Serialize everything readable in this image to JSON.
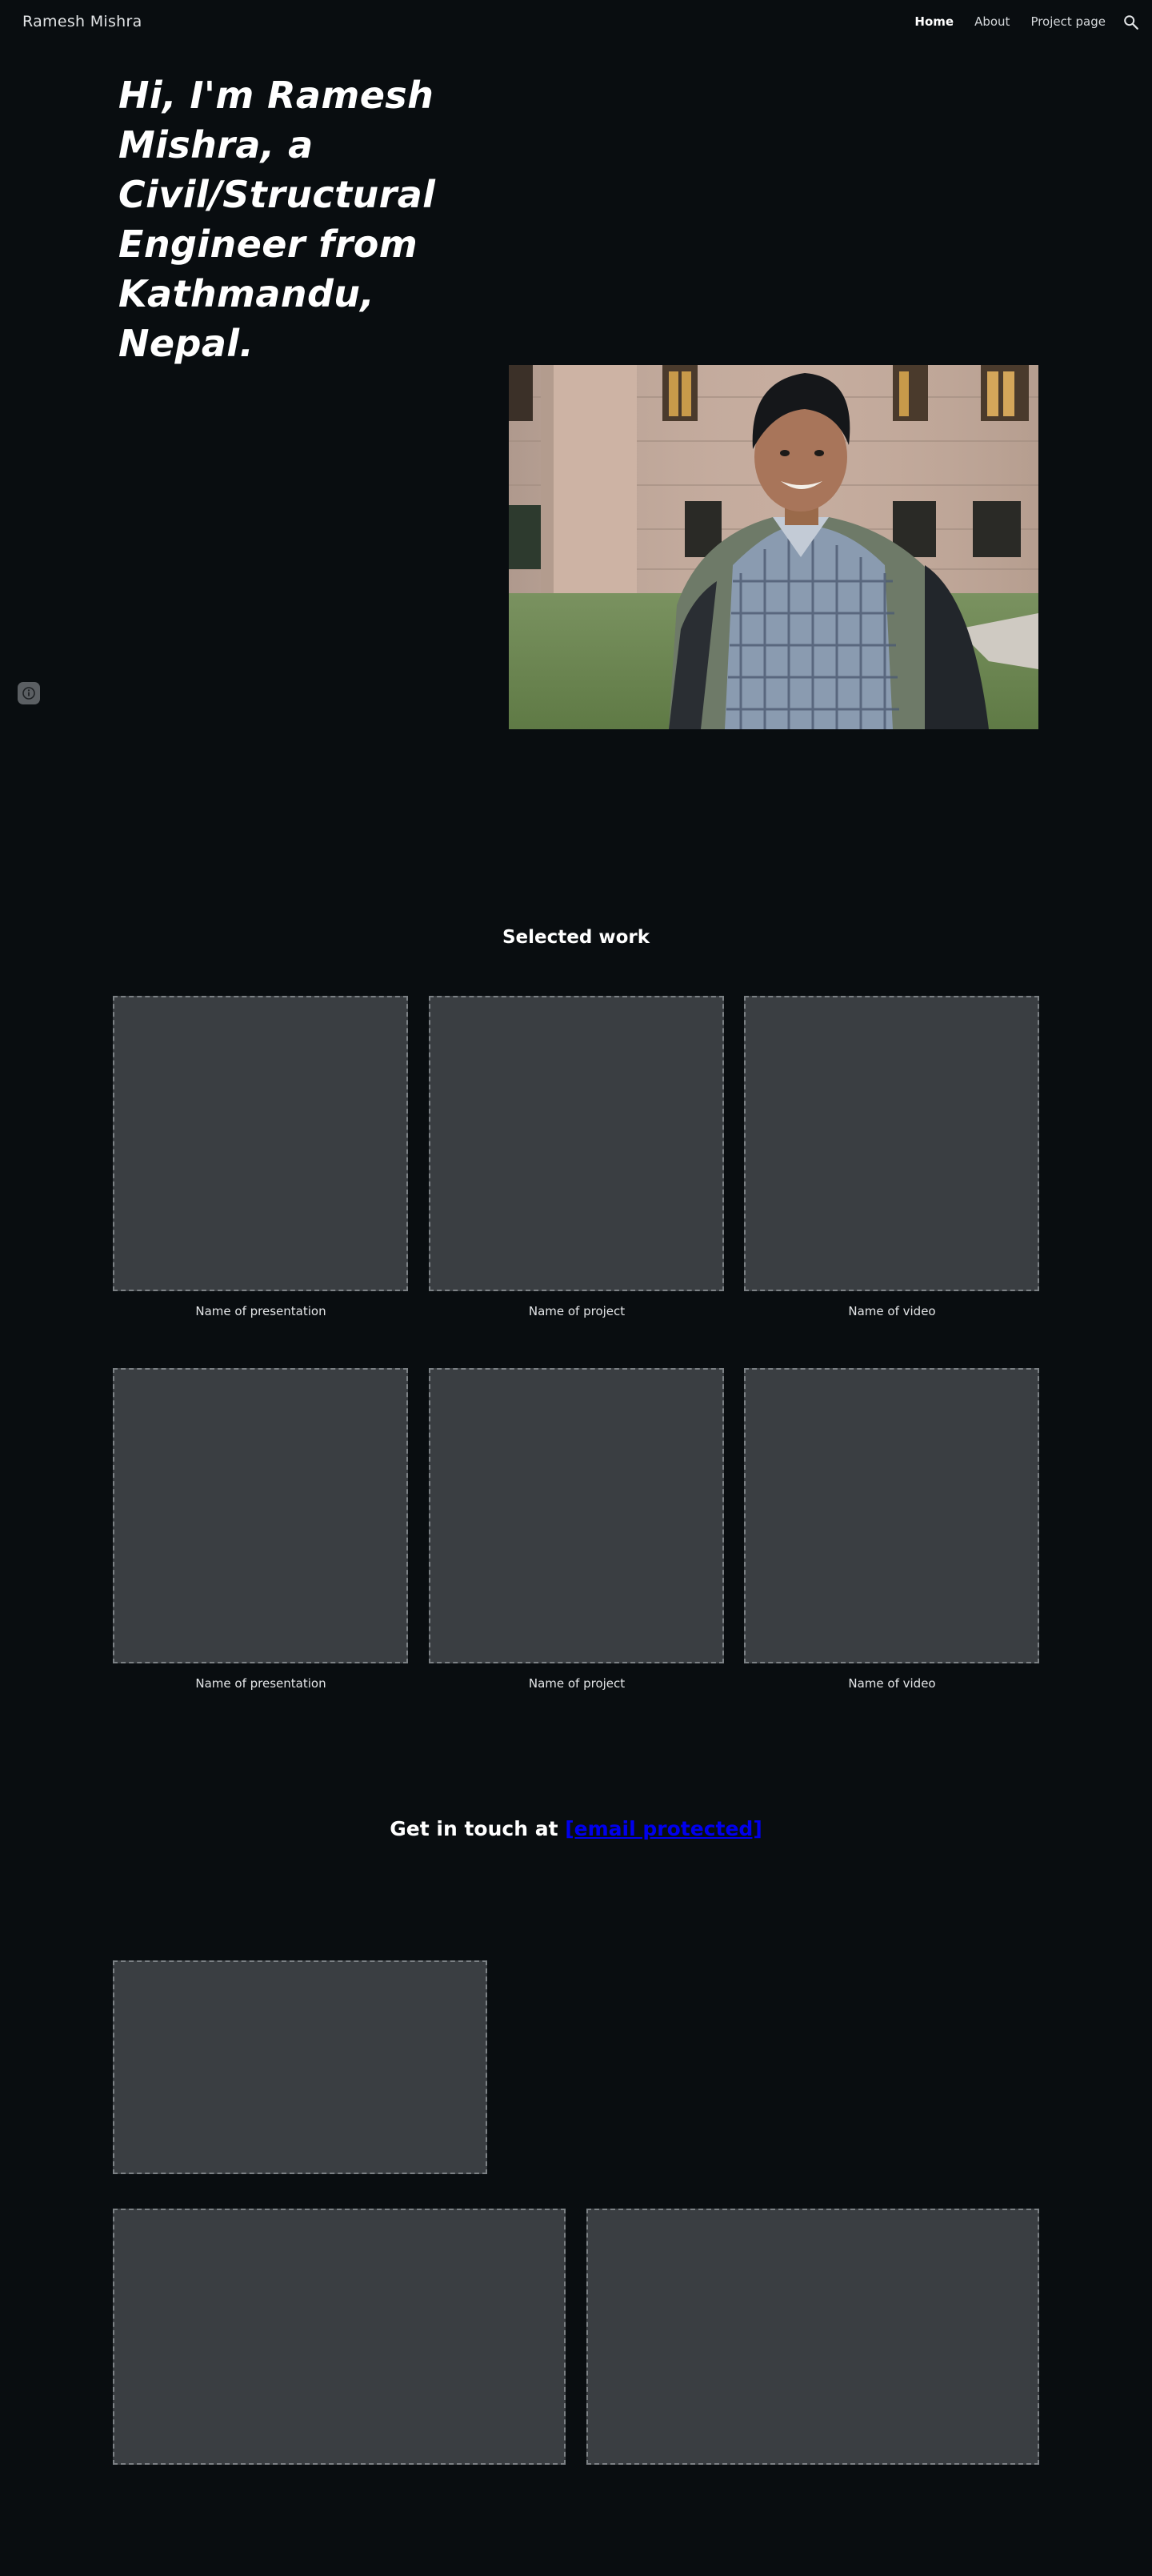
{
  "header": {
    "site_title": "Ramesh Mishra",
    "nav": [
      "Home",
      "About",
      "Project page"
    ],
    "active_nav": "Home",
    "search_icon": "search-icon"
  },
  "hero": {
    "heading": "Hi, I'm Ramesh Mishra, a Civil/Structural Engineer from Kathmandu, Nepal."
  },
  "selected_work": {
    "title": "Selected work",
    "row1": [
      "Name of presentation",
      "Name of project",
      "Name of video"
    ],
    "row2": [
      "Name of presentation",
      "Name of project",
      "Name of video"
    ]
  },
  "contact": {
    "prefix": "Get in touch at",
    "email": "[email protected]"
  },
  "colors": {
    "background": "#090d10",
    "placeholder": "#3a3e42",
    "link": "#0000ee"
  }
}
